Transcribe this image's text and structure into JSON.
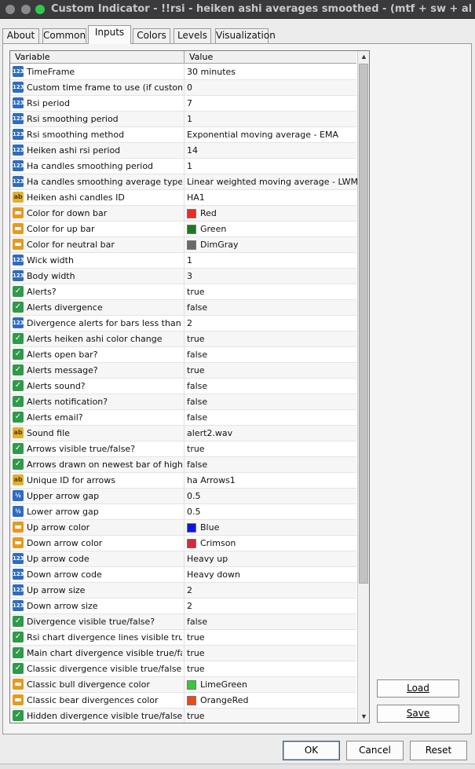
{
  "window": {
    "title": "Custom Indicator - !!rsi - heiken ashi averages smoothed -  (mtf + sw + alerts + arr..."
  },
  "tabs": [
    {
      "label": "About"
    },
    {
      "label": "Common"
    },
    {
      "label": "Inputs",
      "active": true
    },
    {
      "label": "Colors"
    },
    {
      "label": "Levels"
    },
    {
      "label": "Visualization"
    }
  ],
  "grid": {
    "headers": {
      "variable": "Variable",
      "value": "Value"
    },
    "rows": [
      {
        "type": "int",
        "icon": "numeric-icon",
        "variable": "TimeFrame",
        "value": "30 minutes"
      },
      {
        "type": "int",
        "icon": "numeric-icon",
        "variable": "Custom time frame to use (if custom ti...",
        "value": "0"
      },
      {
        "type": "int",
        "icon": "numeric-icon",
        "variable": "Rsi period",
        "value": "7"
      },
      {
        "type": "int",
        "icon": "numeric-icon",
        "variable": "Rsi smoothing period",
        "value": "1"
      },
      {
        "type": "int",
        "icon": "numeric-icon",
        "variable": "Rsi smoothing method",
        "value": "Exponential moving average - EMA"
      },
      {
        "type": "int",
        "icon": "numeric-icon",
        "variable": "Heiken ashi rsi period",
        "value": "14"
      },
      {
        "type": "int",
        "icon": "numeric-icon",
        "variable": "Ha candles smoothing period",
        "value": "1"
      },
      {
        "type": "int",
        "icon": "numeric-icon",
        "variable": "Ha candles smoothing average type",
        "value": "Linear weighted moving average - LWMA"
      },
      {
        "type": "string",
        "icon": "string-icon",
        "variable": "Heiken ashi candles ID",
        "value": "HA1"
      },
      {
        "type": "color",
        "icon": "color-icon",
        "variable": "Color for down bar",
        "value": "Red",
        "swatch": "#ee2b22"
      },
      {
        "type": "color",
        "icon": "color-icon",
        "variable": "Color for up bar",
        "value": "Green",
        "swatch": "#1f7a1f"
      },
      {
        "type": "color",
        "icon": "color-icon",
        "variable": "Color for neutral bar",
        "value": "DimGray",
        "swatch": "#696969"
      },
      {
        "type": "int",
        "icon": "numeric-icon",
        "variable": "Wick width",
        "value": "1"
      },
      {
        "type": "int",
        "icon": "numeric-icon",
        "variable": "Body width",
        "value": "3"
      },
      {
        "type": "bool",
        "icon": "boolean-icon",
        "variable": "Alerts?",
        "value": "true"
      },
      {
        "type": "bool",
        "icon": "boolean-icon",
        "variable": "Alerts divergence",
        "value": "false"
      },
      {
        "type": "int",
        "icon": "numeric-icon",
        "variable": "Divergence alerts for bars less than :",
        "value": "2"
      },
      {
        "type": "bool",
        "icon": "boolean-icon",
        "variable": "Alerts heiken ashi color change",
        "value": "true"
      },
      {
        "type": "bool",
        "icon": "boolean-icon",
        "variable": "Alerts open bar?",
        "value": "false"
      },
      {
        "type": "bool",
        "icon": "boolean-icon",
        "variable": "Alerts message?",
        "value": "true"
      },
      {
        "type": "bool",
        "icon": "boolean-icon",
        "variable": "Alerts sound?",
        "value": "false"
      },
      {
        "type": "bool",
        "icon": "boolean-icon",
        "variable": "Alerts notification?",
        "value": "false"
      },
      {
        "type": "bool",
        "icon": "boolean-icon",
        "variable": "Alerts email?",
        "value": "false"
      },
      {
        "type": "string",
        "icon": "string-icon",
        "variable": "Sound file",
        "value": "alert2.wav"
      },
      {
        "type": "bool",
        "icon": "boolean-icon",
        "variable": "Arrows visible true/false?",
        "value": "true"
      },
      {
        "type": "bool",
        "icon": "boolean-icon",
        "variable": "Arrows drawn on newest bar of highe...",
        "value": "false"
      },
      {
        "type": "string",
        "icon": "string-icon",
        "variable": "Unique ID for arrows",
        "value": "ha Arrows1"
      },
      {
        "type": "double",
        "icon": "double-icon",
        "variable": "Upper arrow gap",
        "value": "0.5"
      },
      {
        "type": "double",
        "icon": "double-icon",
        "variable": "Lower arrow gap",
        "value": "0.5"
      },
      {
        "type": "color",
        "icon": "color-icon",
        "variable": "Up arrow color",
        "value": "Blue",
        "swatch": "#0a14e8"
      },
      {
        "type": "color",
        "icon": "color-icon",
        "variable": "Down arrow color",
        "value": "Crimson",
        "swatch": "#d8283c"
      },
      {
        "type": "int",
        "icon": "numeric-icon",
        "variable": "Up arrow code",
        "value": "Heavy up"
      },
      {
        "type": "int",
        "icon": "numeric-icon",
        "variable": "Down arrow code",
        "value": "Heavy down"
      },
      {
        "type": "int",
        "icon": "numeric-icon",
        "variable": "Up arrow size",
        "value": "2"
      },
      {
        "type": "int",
        "icon": "numeric-icon",
        "variable": "Down arrow size",
        "value": "2"
      },
      {
        "type": "bool",
        "icon": "boolean-icon",
        "variable": "Divergence visible true/false?",
        "value": "false"
      },
      {
        "type": "bool",
        "icon": "boolean-icon",
        "variable": "Rsi chart divergence lines visible true/...",
        "value": "true"
      },
      {
        "type": "bool",
        "icon": "boolean-icon",
        "variable": "Main chart divergence visible true/false?",
        "value": "true"
      },
      {
        "type": "bool",
        "icon": "boolean-icon",
        "variable": "Classic divergence visible true/false?",
        "value": "true"
      },
      {
        "type": "color",
        "icon": "color-icon",
        "variable": "Classic bull divergence color",
        "value": "LimeGreen",
        "swatch": "#38c838"
      },
      {
        "type": "color",
        "icon": "color-icon",
        "variable": "Classic bear divergences color",
        "value": "OrangeRed",
        "swatch": "#ee4a18"
      },
      {
        "type": "bool",
        "icon": "boolean-icon",
        "variable": "Hidden divergence visible true/false?",
        "value": "true"
      }
    ]
  },
  "side_buttons": {
    "load": "Load",
    "save": "Save"
  },
  "footer": {
    "ok": "OK",
    "cancel": "Cancel",
    "reset": "Reset"
  }
}
